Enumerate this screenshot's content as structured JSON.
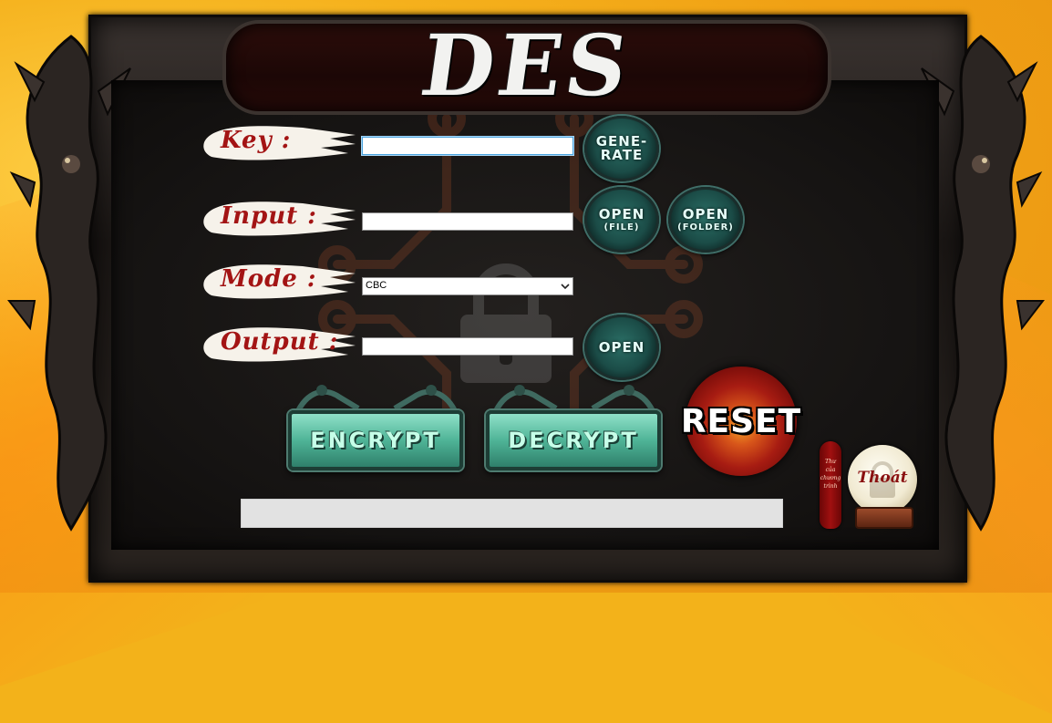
{
  "app": {
    "title": "DES"
  },
  "labels": {
    "key": "Key :",
    "input": "Input :",
    "mode": "Mode :",
    "output": "Output :"
  },
  "fields": {
    "key_value": "",
    "input_value": "",
    "output_value": "",
    "mode_selected": "CBC"
  },
  "buttons": {
    "generate_line1": "GENE-",
    "generate_line2": "RATE",
    "open_file_line1": "OPEN",
    "open_file_line2": "(FILE)",
    "open_folder_line1": "OPEN",
    "open_folder_line2": "(FOLDER)",
    "open_output": "OPEN",
    "encrypt": "ENCRYPT",
    "decrypt": "DECRYPT",
    "reset": "RESET",
    "exit": "Thoát"
  },
  "status_bar": {
    "text": ""
  },
  "side_note": {
    "text": "Thư của chương trình"
  },
  "colors": {
    "label_red": "#a31414",
    "button_teal": "#4fb497",
    "reset_red": "#a71c12",
    "desktop_orange": "#f5b11c"
  }
}
